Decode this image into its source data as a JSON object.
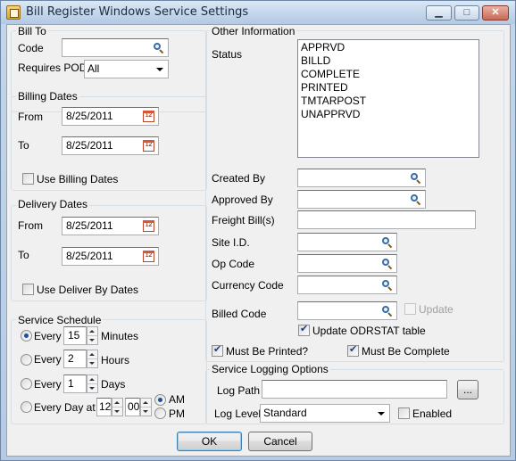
{
  "window": {
    "title": "Bill Register Windows Service Settings",
    "icon": "app-icon"
  },
  "bill_to": {
    "legend": "Bill To",
    "code_label": "Code",
    "code_value": "",
    "requires_pod_label": "Requires POD",
    "requires_pod_value": "All"
  },
  "billing_dates": {
    "legend": "Billing Dates",
    "from_label": "From",
    "from_value": "8/25/2011",
    "to_label": "To",
    "to_value": "8/25/2011",
    "use_label": "Use Billing Dates",
    "use_checked": false
  },
  "delivery_dates": {
    "legend": "Delivery Dates",
    "from_label": "From",
    "from_value": "8/25/2011",
    "to_label": "To",
    "to_value": "8/25/2011",
    "use_label": "Use Deliver By Dates",
    "use_checked": false
  },
  "service_schedule": {
    "legend": "Service Schedule",
    "every_label": "Every",
    "minutes_value": "15",
    "minutes_label": "Minutes",
    "hours_value": "2",
    "hours_label": "Hours",
    "days_value": "1",
    "days_label": "Days",
    "every_day_at_label": "Every Day at",
    "hour_value": "12",
    "minute_value": "00",
    "am_label": "AM",
    "pm_label": "PM",
    "selected": "minutes",
    "ampm_selected": "AM"
  },
  "other_info": {
    "legend": "Other Information",
    "status_label": "Status",
    "status_items": [
      "APPRVD",
      "BILLD",
      "COMPLETE",
      "PRINTED",
      "TMTARPOST",
      "UNAPPRVD"
    ],
    "created_by_label": "Created By",
    "created_by_value": "",
    "approved_by_label": "Approved By",
    "approved_by_value": "",
    "freight_bills_label": "Freight Bill(s)",
    "freight_bills_value": "",
    "site_id_label": "Site I.D.",
    "site_id_value": "",
    "op_code_label": "Op Code",
    "op_code_value": "",
    "currency_code_label": "Currency Code",
    "currency_code_value": "",
    "billed_code_label": "Billed Code",
    "billed_code_value": "",
    "update_label": "Update",
    "update_checked": false,
    "update_odrstat_label": "Update ODRSTAT table",
    "update_odrstat_checked": true,
    "must_be_printed_label": "Must Be Printed?",
    "must_be_printed_checked": true,
    "must_be_complete_label": "Must Be Complete",
    "must_be_complete_checked": true
  },
  "logging": {
    "legend": "Service Logging Options",
    "log_path_label": "Log Path",
    "log_path_value": "",
    "browse_label": "...",
    "log_level_label": "Log Level",
    "log_level_value": "Standard",
    "enabled_label": "Enabled",
    "enabled_checked": false
  },
  "buttons": {
    "ok": "OK",
    "cancel": "Cancel"
  },
  "colors": {
    "titlebar": "#c4d7ec",
    "client": "#f0f0f0",
    "close": "#c86b56"
  }
}
